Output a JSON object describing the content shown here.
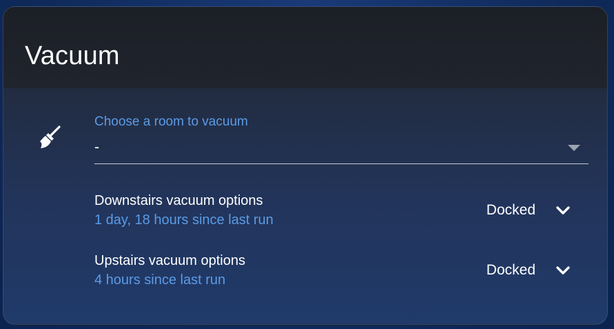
{
  "card": {
    "title": "Vacuum"
  },
  "room_select": {
    "icon": "broom-icon",
    "label": "Choose a room to vacuum",
    "value": "-"
  },
  "vacuums": [
    {
      "name": "Downstairs vacuum options",
      "last_run": "1 day, 18 hours since last run",
      "state": "Docked"
    },
    {
      "name": "Upstairs vacuum options",
      "last_run": "4 hours since last run",
      "state": "Docked"
    }
  ],
  "colors": {
    "accent": "#5b9be6",
    "text": "#ffffff",
    "header_bg": "#1c1f26"
  }
}
